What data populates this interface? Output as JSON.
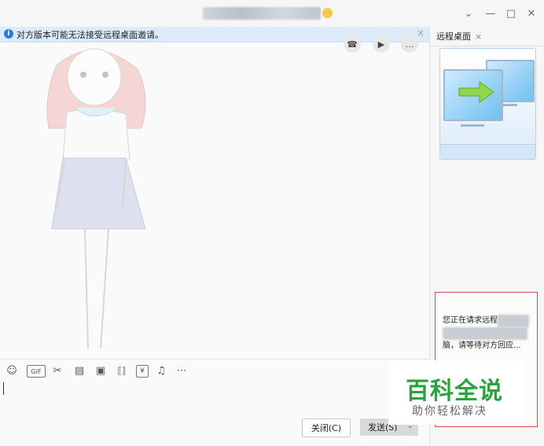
{
  "window": {
    "title": "██████████████",
    "controls": {
      "dropdown": "⌄",
      "minimize": "—",
      "maximize": "□",
      "close": "✕"
    }
  },
  "banner": {
    "info_glyph": "i",
    "text": "对方版本可能无法接受远程桌面邀请。",
    "close": "×"
  },
  "call_actions": {
    "phone": "☎",
    "video": "▶",
    "more": "…"
  },
  "toolbar": {
    "emoji": "☺",
    "gif": "GIF",
    "scissors": "✂",
    "folder": "▤",
    "image": "▣",
    "shake": "⟦⟧",
    "redpacket": "¥",
    "music": "♫",
    "more": "⋯"
  },
  "buttons": {
    "close": "关闭(C)",
    "send": "发送(S)",
    "send_caret": "⌄"
  },
  "side_panel": {
    "tab_label": "远程桌面",
    "tab_close": "×",
    "status_line1": "您正在请求远程",
    "status_line3": "脑，请等待对方回应..."
  },
  "watermark": {
    "title": "百科全说",
    "subtitle": "助你轻松解决"
  },
  "colors": {
    "accent": "#2c7be5",
    "highlight_border": "#e04545",
    "watermark_green": "#2aa33f"
  }
}
